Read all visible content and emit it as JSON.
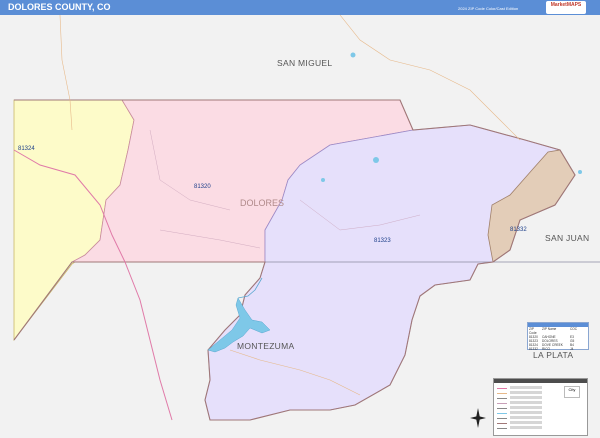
{
  "header": {
    "title": "DOLORES COUNTY, CO",
    "edition": "2024 ZIP Code Color/Cast Edition",
    "logo": "MarketMAPS"
  },
  "map": {
    "counties": {
      "san_miguel": "SAN MIGUEL",
      "dolores": "DOLORES",
      "san_juan": "SAN JUAN",
      "montezuma": "MONTEZUMA",
      "la_plata": "LA PLATA"
    },
    "zips": [
      {
        "code": "81324",
        "color": "#fdfbc9"
      },
      {
        "code": "81320",
        "color": "#fbdce4"
      },
      {
        "code": "81323",
        "color": "#e6e0fb"
      },
      {
        "code": "81332",
        "color": "#e3cdb8"
      }
    ],
    "colors": {
      "background_land": "#f2f2f2",
      "county_border": "#a07878",
      "road_main": "#e07aa8",
      "water": "#7ec8e8",
      "header": "#5b8ed6"
    }
  },
  "legend": {
    "headers": [
      "ZIP Code",
      "ZIP Name",
      "COC"
    ],
    "rows": [
      [
        "81320",
        "CAHONE",
        "E3"
      ],
      [
        "81323",
        "DOLORES",
        "G5"
      ],
      [
        "81324",
        "DOVE CREEK",
        "B4"
      ],
      [
        "81332",
        "RICO",
        "J4"
      ]
    ]
  },
  "key": {
    "city_label": "City",
    "rows": 9
  },
  "icons": {
    "compass": "compass-rose-icon"
  }
}
